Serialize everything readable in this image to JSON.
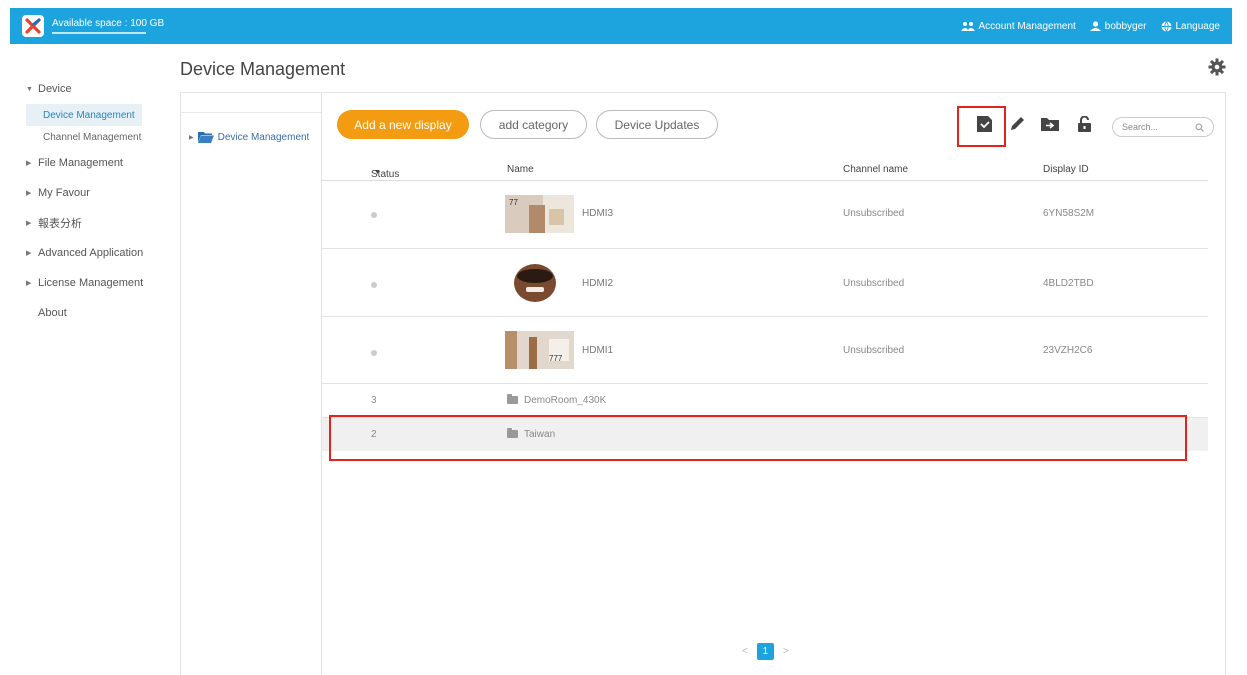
{
  "header": {
    "storage": "Available space : 100 GB",
    "account_management": "Account Management",
    "username": "bobbyger",
    "language": "Language"
  },
  "page_title": "Device Management",
  "sidebar": {
    "items": [
      {
        "label": "Device",
        "expanded": true,
        "children": [
          {
            "label": "Device Management",
            "active": true
          },
          {
            "label": "Channel Management",
            "active": false
          }
        ]
      },
      {
        "label": "File Management"
      },
      {
        "label": "My Favour"
      },
      {
        "label": "報表分析"
      },
      {
        "label": "Advanced Application"
      },
      {
        "label": "License Management"
      },
      {
        "label": "About"
      }
    ]
  },
  "tree": {
    "root": "Device Management"
  },
  "toolbar": {
    "add_display": "Add a new display",
    "add_category": "add category",
    "device_updates": "Device Updates",
    "search_placeholder": "Search..."
  },
  "table": {
    "columns": [
      "Status",
      "Name",
      "Channel name",
      "Display ID"
    ],
    "rows": [
      {
        "status": "",
        "name": "HDMI3",
        "channel": "Unsubscribed",
        "display_id": "6YN58S2M"
      },
      {
        "status": "",
        "name": "HDMI2",
        "channel": "Unsubscribed",
        "display_id": "4BLD2TBD"
      },
      {
        "status": "",
        "name": "HDMI1",
        "channel": "Unsubscribed",
        "display_id": "23VZH2C6"
      },
      {
        "status": "3",
        "name": "DemoRoom_430K",
        "channel": "",
        "display_id": ""
      },
      {
        "status": "2",
        "name": "Taiwan",
        "channel": "",
        "display_id": ""
      }
    ]
  },
  "pagination": {
    "prev": "<",
    "current": "1",
    "next": ">"
  },
  "colors": {
    "header_bg": "#1da3dd",
    "primary_button": "#f39b11",
    "highlight_border": "#e1251b"
  }
}
